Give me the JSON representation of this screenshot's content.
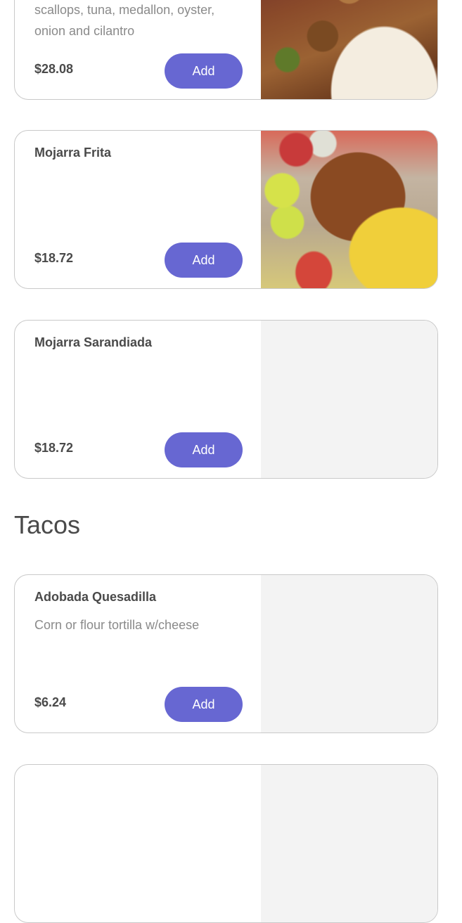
{
  "cards": [
    {
      "name": "",
      "description": "scallops, tuna, medallon, oyster, onion and cilantro",
      "price": "$28.08",
      "add_label": "Add",
      "image": "ceviche-photo"
    },
    {
      "name": "Mojarra Frita",
      "description": "",
      "price": "$18.72",
      "add_label": "Add",
      "image": "fried-fish-photo"
    },
    {
      "name": "Mojarra Sarandiada",
      "description": "",
      "price": "$18.72",
      "add_label": "Add",
      "image": "placeholder"
    },
    {
      "name": "Adobada Quesadilla",
      "description": "Corn or flour tortilla w/cheese",
      "price": "$6.24",
      "add_label": "Add",
      "image": "placeholder"
    }
  ],
  "sections": {
    "tacos_title": "Tacos"
  },
  "colors": {
    "accent": "#6767d2",
    "placeholder": "#f3f3f3",
    "border": "#c9c9c9"
  }
}
